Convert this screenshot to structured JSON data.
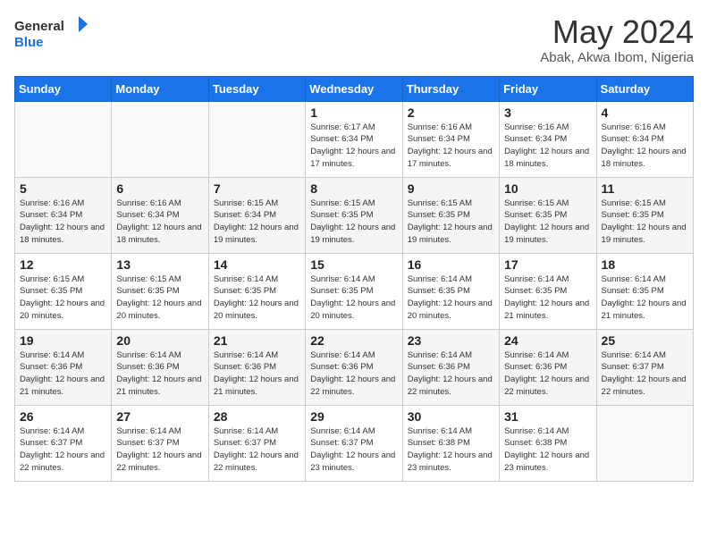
{
  "header": {
    "logo_line1": "General",
    "logo_line2": "Blue",
    "title": "May 2024",
    "subtitle": "Abak, Akwa Ibom, Nigeria"
  },
  "weekdays": [
    "Sunday",
    "Monday",
    "Tuesday",
    "Wednesday",
    "Thursday",
    "Friday",
    "Saturday"
  ],
  "weeks": [
    [
      {
        "day": "",
        "info": ""
      },
      {
        "day": "",
        "info": ""
      },
      {
        "day": "",
        "info": ""
      },
      {
        "day": "1",
        "info": "Sunrise: 6:17 AM\nSunset: 6:34 PM\nDaylight: 12 hours and 17 minutes."
      },
      {
        "day": "2",
        "info": "Sunrise: 6:16 AM\nSunset: 6:34 PM\nDaylight: 12 hours and 17 minutes."
      },
      {
        "day": "3",
        "info": "Sunrise: 6:16 AM\nSunset: 6:34 PM\nDaylight: 12 hours and 18 minutes."
      },
      {
        "day": "4",
        "info": "Sunrise: 6:16 AM\nSunset: 6:34 PM\nDaylight: 12 hours and 18 minutes."
      }
    ],
    [
      {
        "day": "5",
        "info": "Sunrise: 6:16 AM\nSunset: 6:34 PM\nDaylight: 12 hours and 18 minutes."
      },
      {
        "day": "6",
        "info": "Sunrise: 6:16 AM\nSunset: 6:34 PM\nDaylight: 12 hours and 18 minutes."
      },
      {
        "day": "7",
        "info": "Sunrise: 6:15 AM\nSunset: 6:34 PM\nDaylight: 12 hours and 19 minutes."
      },
      {
        "day": "8",
        "info": "Sunrise: 6:15 AM\nSunset: 6:35 PM\nDaylight: 12 hours and 19 minutes."
      },
      {
        "day": "9",
        "info": "Sunrise: 6:15 AM\nSunset: 6:35 PM\nDaylight: 12 hours and 19 minutes."
      },
      {
        "day": "10",
        "info": "Sunrise: 6:15 AM\nSunset: 6:35 PM\nDaylight: 12 hours and 19 minutes."
      },
      {
        "day": "11",
        "info": "Sunrise: 6:15 AM\nSunset: 6:35 PM\nDaylight: 12 hours and 19 minutes."
      }
    ],
    [
      {
        "day": "12",
        "info": "Sunrise: 6:15 AM\nSunset: 6:35 PM\nDaylight: 12 hours and 20 minutes."
      },
      {
        "day": "13",
        "info": "Sunrise: 6:15 AM\nSunset: 6:35 PM\nDaylight: 12 hours and 20 minutes."
      },
      {
        "day": "14",
        "info": "Sunrise: 6:14 AM\nSunset: 6:35 PM\nDaylight: 12 hours and 20 minutes."
      },
      {
        "day": "15",
        "info": "Sunrise: 6:14 AM\nSunset: 6:35 PM\nDaylight: 12 hours and 20 minutes."
      },
      {
        "day": "16",
        "info": "Sunrise: 6:14 AM\nSunset: 6:35 PM\nDaylight: 12 hours and 20 minutes."
      },
      {
        "day": "17",
        "info": "Sunrise: 6:14 AM\nSunset: 6:35 PM\nDaylight: 12 hours and 21 minutes."
      },
      {
        "day": "18",
        "info": "Sunrise: 6:14 AM\nSunset: 6:35 PM\nDaylight: 12 hours and 21 minutes."
      }
    ],
    [
      {
        "day": "19",
        "info": "Sunrise: 6:14 AM\nSunset: 6:36 PM\nDaylight: 12 hours and 21 minutes."
      },
      {
        "day": "20",
        "info": "Sunrise: 6:14 AM\nSunset: 6:36 PM\nDaylight: 12 hours and 21 minutes."
      },
      {
        "day": "21",
        "info": "Sunrise: 6:14 AM\nSunset: 6:36 PM\nDaylight: 12 hours and 21 minutes."
      },
      {
        "day": "22",
        "info": "Sunrise: 6:14 AM\nSunset: 6:36 PM\nDaylight: 12 hours and 22 minutes."
      },
      {
        "day": "23",
        "info": "Sunrise: 6:14 AM\nSunset: 6:36 PM\nDaylight: 12 hours and 22 minutes."
      },
      {
        "day": "24",
        "info": "Sunrise: 6:14 AM\nSunset: 6:36 PM\nDaylight: 12 hours and 22 minutes."
      },
      {
        "day": "25",
        "info": "Sunrise: 6:14 AM\nSunset: 6:37 PM\nDaylight: 12 hours and 22 minutes."
      }
    ],
    [
      {
        "day": "26",
        "info": "Sunrise: 6:14 AM\nSunset: 6:37 PM\nDaylight: 12 hours and 22 minutes."
      },
      {
        "day": "27",
        "info": "Sunrise: 6:14 AM\nSunset: 6:37 PM\nDaylight: 12 hours and 22 minutes."
      },
      {
        "day": "28",
        "info": "Sunrise: 6:14 AM\nSunset: 6:37 PM\nDaylight: 12 hours and 22 minutes."
      },
      {
        "day": "29",
        "info": "Sunrise: 6:14 AM\nSunset: 6:37 PM\nDaylight: 12 hours and 23 minutes."
      },
      {
        "day": "30",
        "info": "Sunrise: 6:14 AM\nSunset: 6:38 PM\nDaylight: 12 hours and 23 minutes."
      },
      {
        "day": "31",
        "info": "Sunrise: 6:14 AM\nSunset: 6:38 PM\nDaylight: 12 hours and 23 minutes."
      },
      {
        "day": "",
        "info": ""
      }
    ]
  ]
}
